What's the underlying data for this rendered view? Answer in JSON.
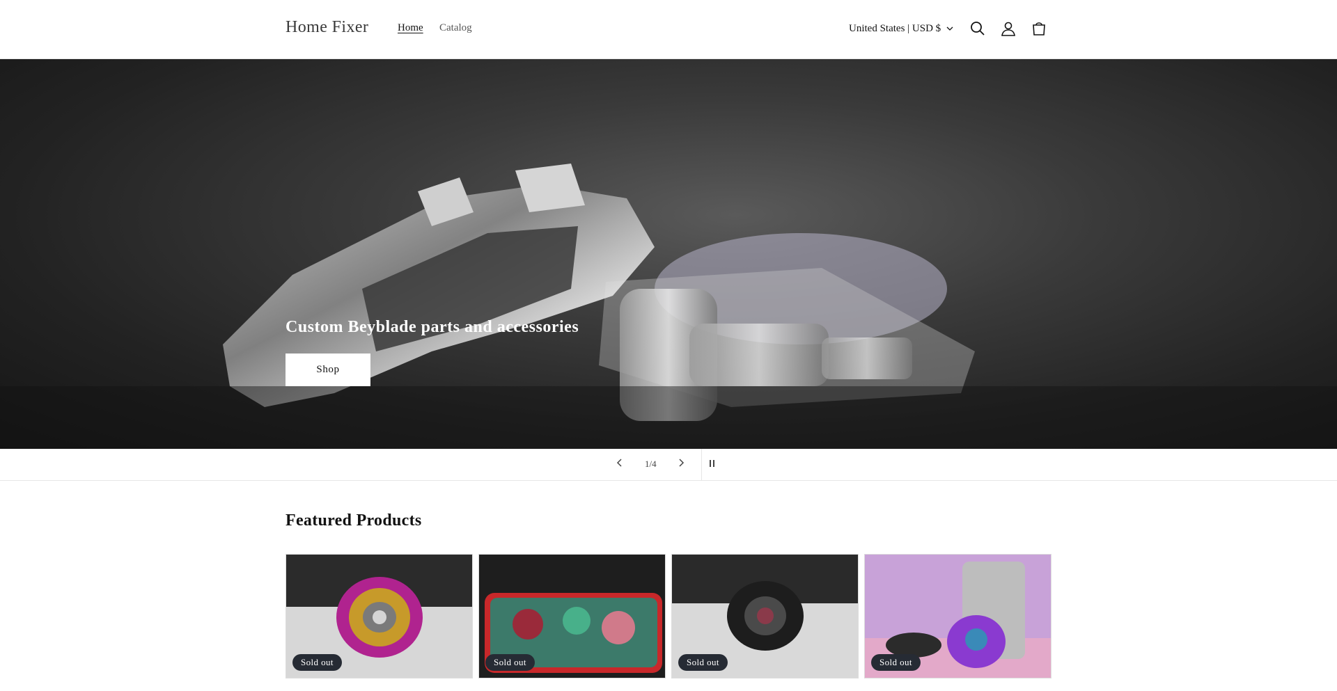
{
  "header": {
    "logo": "Home Fixer",
    "nav": [
      {
        "label": "Home"
      },
      {
        "label": "Catalog"
      }
    ],
    "locale": "United States | USD $",
    "icons": [
      "search-icon",
      "account-icon",
      "cart-icon"
    ]
  },
  "hero": {
    "title": "Custom Beyblade parts and accessories",
    "button_label": "Shop"
  },
  "slider": {
    "counter": "1/4"
  },
  "featured": {
    "title": "Featured Products",
    "products": [
      {
        "badge": "Sold out"
      },
      {
        "badge": "Sold out"
      },
      {
        "badge": "Sold out"
      },
      {
        "badge": "Sold out"
      }
    ]
  },
  "colors": {
    "badge_bg": "#262b34",
    "hero_bg": "#2a2a2a"
  }
}
